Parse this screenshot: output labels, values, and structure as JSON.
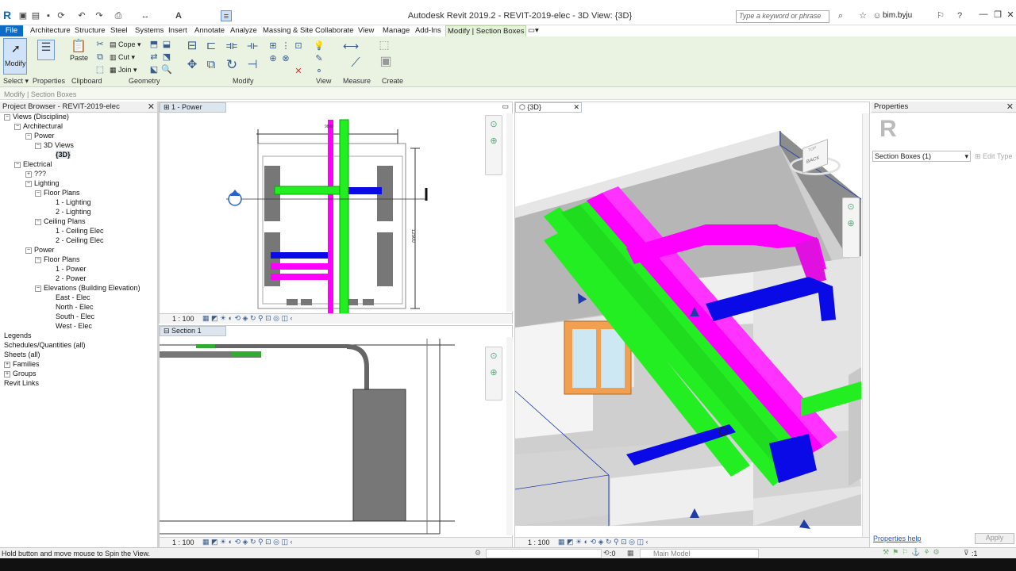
{
  "app": {
    "title": "Autodesk Revit 2019.2 - REVIT-2019-elec - 3D View: {3D}",
    "logo": "R"
  },
  "search": {
    "placeholder": "Type a keyword or phrase"
  },
  "user": {
    "name": "bim.byju"
  },
  "tabs": [
    "File",
    "Architecture",
    "Structure",
    "Steel",
    "Systems",
    "Insert",
    "Annotate",
    "Analyze",
    "Massing & Site",
    "Collaborate",
    "View",
    "Manage",
    "Add-Ins",
    "Modify | Section Boxes"
  ],
  "ribbon": {
    "groups": [
      "Select",
      "Properties",
      "Clipboard",
      "Geometry",
      "Modify",
      "View",
      "Measure",
      "Create"
    ],
    "modify_label": "Modify",
    "paste_label": "Paste",
    "cope_label": "Cope",
    "cut_label": "Cut",
    "join_label": "Join",
    "properties_label": "Properties"
  },
  "context_bar": "Modify | Section Boxes",
  "project_browser": {
    "title": "Project Browser - REVIT-2019-elec",
    "nodes": [
      {
        "label": "Views (Discipline)",
        "toggle": "−"
      },
      {
        "label": "Architectural",
        "toggle": "−"
      },
      {
        "label": "Power",
        "toggle": "−"
      },
      {
        "label": "3D Views",
        "toggle": "−"
      },
      {
        "label": "{3D}",
        "toggle": ""
      },
      {
        "label": "Electrical",
        "toggle": "−"
      },
      {
        "label": "???",
        "toggle": "+"
      },
      {
        "label": "Lighting",
        "toggle": "−"
      },
      {
        "label": "Floor Plans",
        "toggle": "−"
      },
      {
        "label": "1 - Lighting",
        "toggle": ""
      },
      {
        "label": "2 - Lighting",
        "toggle": ""
      },
      {
        "label": "Ceiling Plans",
        "toggle": "−"
      },
      {
        "label": "1 - Ceiling Elec",
        "toggle": ""
      },
      {
        "label": "2 - Ceiling Elec",
        "toggle": ""
      },
      {
        "label": "Power",
        "toggle": "−"
      },
      {
        "label": "Floor Plans",
        "toggle": "−"
      },
      {
        "label": "1 - Power",
        "toggle": ""
      },
      {
        "label": "2 - Power",
        "toggle": ""
      },
      {
        "label": "Elevations (Building Elevation)",
        "toggle": "−"
      },
      {
        "label": "East - Elec",
        "toggle": ""
      },
      {
        "label": "North - Elec",
        "toggle": ""
      },
      {
        "label": "South - Elec",
        "toggle": ""
      },
      {
        "label": "West - Elec",
        "toggle": ""
      },
      {
        "label": "Legends",
        "toggle": ""
      },
      {
        "label": "Schedules/Quantities (all)",
        "toggle": ""
      },
      {
        "label": "Sheets (all)",
        "toggle": ""
      },
      {
        "label": "Families",
        "toggle": "+"
      },
      {
        "label": "Groups",
        "toggle": "+"
      },
      {
        "label": "Revit Links",
        "toggle": ""
      }
    ]
  },
  "views": {
    "power": {
      "title": "1 - Power",
      "scale": "1 : 100",
      "dim_label": "12500",
      "top_dim": "9800"
    },
    "section": {
      "title": "Section 1",
      "scale": "1 : 100"
    },
    "threed": {
      "title": "{3D}",
      "scale": "1 : 100",
      "viewcube_face": "BACK",
      "viewcube_top": "TOP"
    }
  },
  "properties": {
    "title": "Properties",
    "type_selector": "Section Boxes (1)",
    "edit_type": "Edit Type",
    "help_link": "Properties help",
    "apply": "Apply"
  },
  "statusbar": {
    "hint": "Hold button and move mouse to Spin the View.",
    "counter": ":0",
    "model": "Main Model",
    "filter_count": ":1"
  },
  "colors": {
    "magenta": "#ff00ff",
    "green": "#22ee22",
    "blue": "#0a0ae6",
    "ribbon": "#eaf3e2",
    "file_tab": "#0b6bc7"
  }
}
